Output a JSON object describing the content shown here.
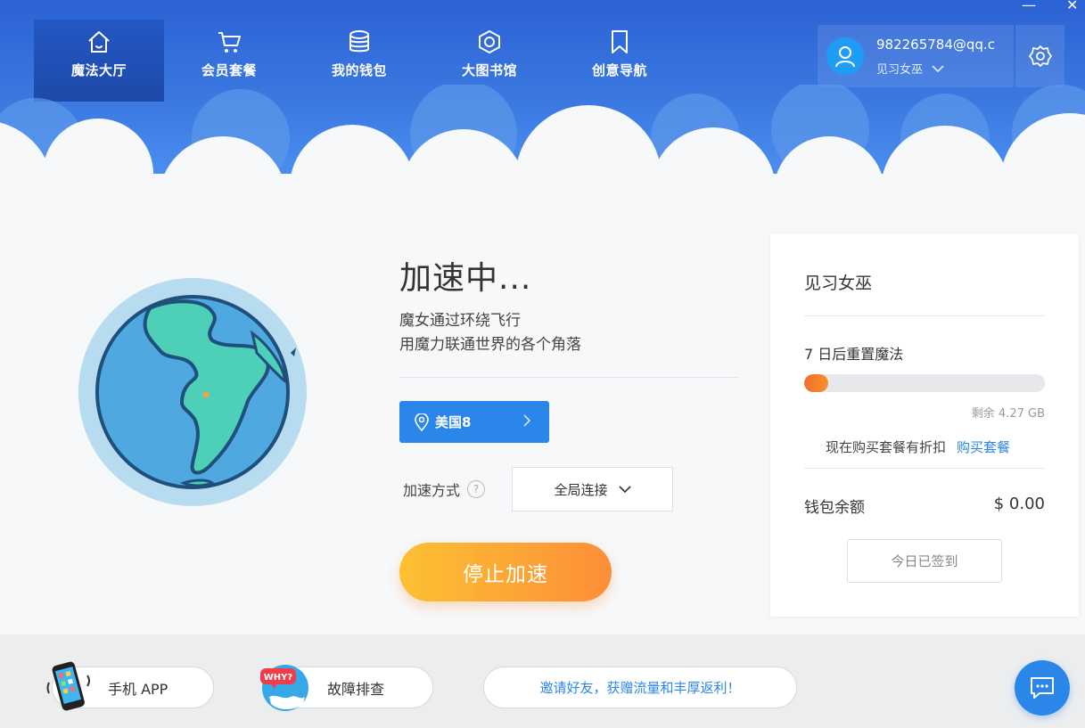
{
  "nav": {
    "items": [
      {
        "label": "魔法大厅",
        "icon": "home-icon"
      },
      {
        "label": "会员套餐",
        "icon": "cart-icon"
      },
      {
        "label": "我的钱包",
        "icon": "wallet-icon"
      },
      {
        "label": "大图书馆",
        "icon": "library-icon"
      },
      {
        "label": "创意导航",
        "icon": "bookmark-icon"
      }
    ]
  },
  "user": {
    "email": "982265784@qq.c",
    "level": "见习女巫"
  },
  "window": {
    "minimize": "—",
    "close": "✕"
  },
  "main": {
    "status_title": "加速中...",
    "desc_line1": "魔女通过环绕飞行",
    "desc_line2": "用魔力联通世界的各个角落",
    "server": "美国8",
    "mode_label": "加速方式",
    "mode_value": "全局连接",
    "stop_label": "停止加速"
  },
  "card": {
    "level": "见习女巫",
    "reset_text": "7 日后重置魔法",
    "progress_fraction": 0.1,
    "remaining": "剩余 4.27 GB",
    "promo_text": "现在购买套餐有折扣",
    "promo_link": "购买套餐",
    "wallet_label": "钱包余额",
    "wallet_value": "$ 0.00",
    "signin_label": "今日已签到"
  },
  "footer": {
    "app_label": "手机 APP",
    "trouble_label": "故障排查",
    "invite_label": "邀请好友，获赠流量和丰厚返利！",
    "why_badge": "WHY?"
  },
  "colors": {
    "header": "#3a78e0",
    "accent_blue": "#2a86e8",
    "orange": "#fd8e38",
    "yellow": "#fcc132"
  }
}
